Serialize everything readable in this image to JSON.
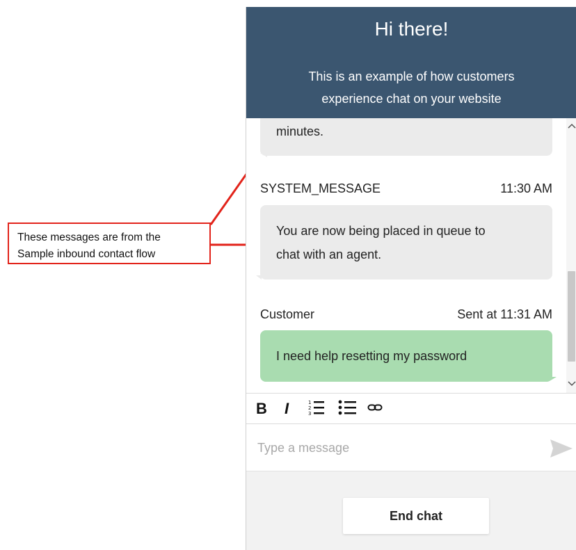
{
  "callout": {
    "line1": "These messages are from the",
    "line2": "Sample inbound contact flow"
  },
  "header": {
    "title": "Hi there!",
    "subtitle_line1": "This is an example of how customers",
    "subtitle_line2": "experience chat on your website"
  },
  "messages": [
    {
      "text": "minutes."
    },
    {
      "sender": "SYSTEM_MESSAGE",
      "time": "11:30 AM",
      "line1": "You are now being placed in queue to",
      "line2": "chat with an agent."
    },
    {
      "sender": "Customer",
      "sent_label": "Sent at",
      "time": "11:31 AM",
      "text": "I need help resetting my password"
    }
  ],
  "toolbar": {
    "bold": "B",
    "italic": "I"
  },
  "input": {
    "placeholder": "Type a message",
    "value": ""
  },
  "footer": {
    "end_chat_label": "End chat"
  },
  "colors": {
    "header_bg": "#3b5670",
    "customer_bubble": "#a9dcb0",
    "system_bubble": "#ebebeb",
    "callout_border": "#e2231a"
  },
  "icons": [
    "numbered-list-icon",
    "bulleted-list-icon",
    "link-icon",
    "send-icon",
    "scroll-up-icon",
    "scroll-down-icon"
  ]
}
